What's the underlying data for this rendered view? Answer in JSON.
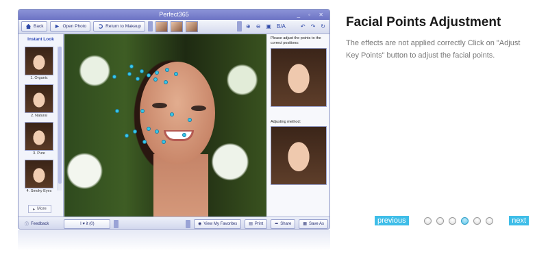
{
  "app": {
    "title": "Perfect365",
    "toolbar": {
      "back": "Back",
      "open_photo": "Open Photo",
      "return_to_makeup": "Return to Makeup",
      "before_after": "B/A"
    },
    "left_panel": {
      "header": "Instant Look",
      "looks": [
        "1. Organic",
        "2. Natural",
        "3. Pure",
        "4. Smoky Eyes"
      ],
      "more": "More"
    },
    "right_panel": {
      "instruction": "Please adjust the points to the correct positions:",
      "adjusting_method": "Adjusting method:"
    },
    "bottom_bar": {
      "feedback": "Feedback",
      "like": "I ♥ it (0)",
      "view_favorites": "View My Favorites",
      "print": "Print",
      "share": "Share",
      "save_as": "Save As"
    }
  },
  "content": {
    "heading": "Facial Points Adjustment",
    "description": "The effects are not applied correctly Click on \"Adjust Key Points\" button to adjust the facial points."
  },
  "pager": {
    "previous": "previous",
    "next": "next",
    "total": 6,
    "active_index": 3
  },
  "colors": {
    "accent": "#3ebde8",
    "title_bar": "#7b82cf",
    "point": "#39c8e8"
  }
}
